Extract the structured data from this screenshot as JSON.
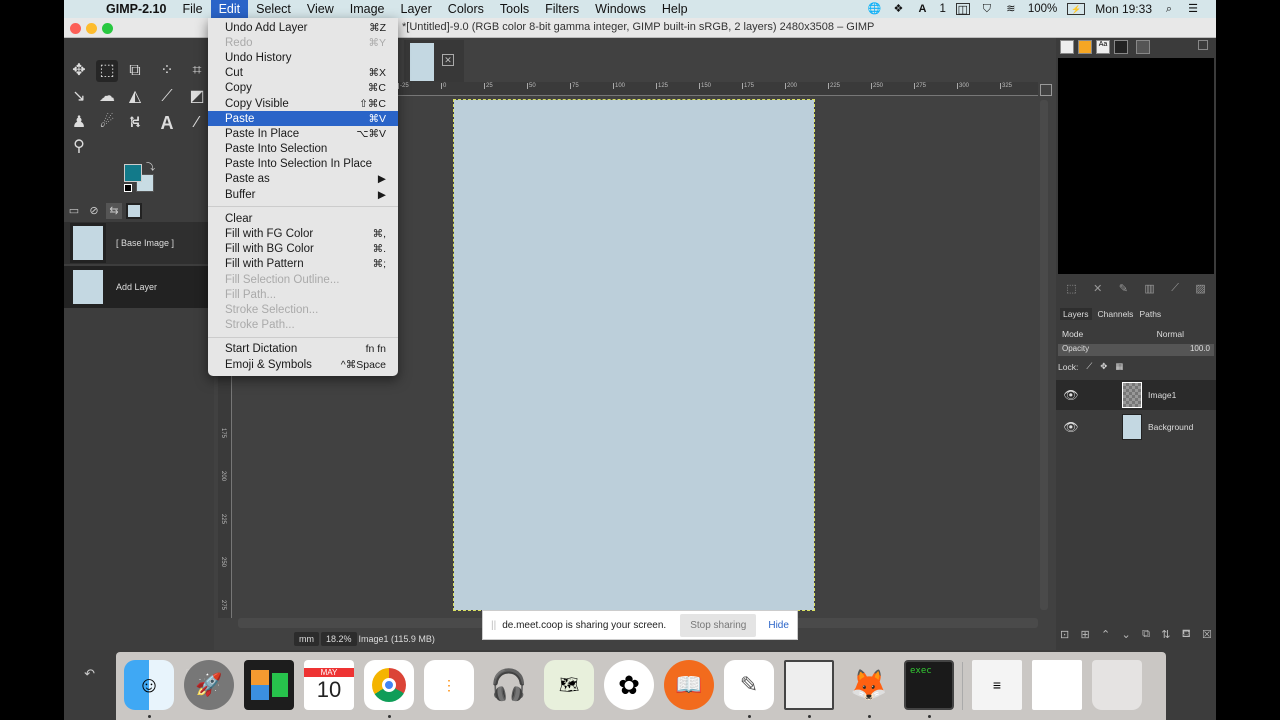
{
  "menubar": {
    "app_name": "GIMP-2.10",
    "items": [
      "File",
      "Edit",
      "Select",
      "View",
      "Image",
      "Layer",
      "Colors",
      "Tools",
      "Filters",
      "Windows",
      "Help"
    ],
    "active_item": "Edit",
    "battery": "100%",
    "clock": "Mon 19:33",
    "notification_count": "1"
  },
  "window": {
    "title": "*[Untitled]-9.0 (RGB color 8-bit gamma integer, GIMP built-in sRGB, 2 layers) 2480x3508 – GIMP"
  },
  "edit_menu": {
    "items": [
      {
        "label": "Undo Add Layer",
        "shortcut": "⌘Z",
        "enabled": true
      },
      {
        "label": "Redo",
        "shortcut": "⌘Y",
        "enabled": false
      },
      {
        "label": "Undo History",
        "shortcut": "",
        "enabled": true
      },
      {
        "label": "Cut",
        "shortcut": "⌘X",
        "enabled": true
      },
      {
        "label": "Copy",
        "shortcut": "⌘C",
        "enabled": true
      },
      {
        "label": "Copy Visible",
        "shortcut": "⇧⌘C",
        "enabled": true
      },
      {
        "label": "Paste",
        "shortcut": "⌘V",
        "enabled": true,
        "highlighted": true
      },
      {
        "label": "Paste In Place",
        "shortcut": "⌥⌘V",
        "enabled": true
      },
      {
        "label": "Paste Into Selection",
        "shortcut": "",
        "enabled": true
      },
      {
        "label": "Paste Into Selection In Place",
        "shortcut": "",
        "enabled": true
      },
      {
        "label": "Paste as",
        "shortcut": "▶",
        "enabled": true
      },
      {
        "label": "Buffer",
        "shortcut": "▶",
        "enabled": true
      },
      {
        "label": "Clear",
        "shortcut": "",
        "enabled": true
      },
      {
        "label": "Fill with FG Color",
        "shortcut": "⌘,",
        "enabled": true
      },
      {
        "label": "Fill with BG Color",
        "shortcut": "⌘.",
        "enabled": true
      },
      {
        "label": "Fill with Pattern",
        "shortcut": "⌘;",
        "enabled": true
      },
      {
        "label": "Fill Selection Outline...",
        "shortcut": "",
        "enabled": false
      },
      {
        "label": "Fill Path...",
        "shortcut": "",
        "enabled": false
      },
      {
        "label": "Stroke Selection...",
        "shortcut": "",
        "enabled": false
      },
      {
        "label": "Stroke Path...",
        "shortcut": "",
        "enabled": false
      },
      {
        "label": "Start Dictation",
        "shortcut": "fn fn",
        "enabled": true
      },
      {
        "label": "Emoji & Symbols",
        "shortcut": "^⌘Space",
        "enabled": true
      }
    ]
  },
  "toolbox": {
    "fg_color": "#127a8a",
    "bg_color": "#c8dce4",
    "history": [
      {
        "label": "[ Base Image ]"
      },
      {
        "label": "Add Layer"
      }
    ]
  },
  "rulers": {
    "horizontal_ticks": [
      "-25",
      "0",
      "25",
      "50",
      "75",
      "100",
      "125",
      "150",
      "175",
      "200",
      "225",
      "250",
      "275",
      "300",
      "325"
    ],
    "vertical_ticks": [
      "175",
      "200",
      "225",
      "250",
      "275"
    ]
  },
  "statusbar": {
    "unit": "mm",
    "zoom": "18.2%",
    "info": "Image1 (115.9 MB)"
  },
  "share_notice": {
    "text": "de.meet.coop is sharing your screen.",
    "stop_label": "Stop sharing",
    "hide_label": "Hide"
  },
  "layers_panel": {
    "tabs": [
      "Layers",
      "Channels",
      "Paths"
    ],
    "mode_label": "Mode",
    "mode_value": "Normal",
    "opacity_label": "Opacity",
    "opacity_value": "100.0",
    "lock_label": "Lock:",
    "layers": [
      {
        "name": "Image1",
        "visible": true,
        "selected": true
      },
      {
        "name": "Background",
        "visible": true,
        "selected": false
      }
    ]
  },
  "dock": {
    "apps": [
      "Finder",
      "Launchpad",
      "Mission Control",
      "Calendar",
      "Chrome",
      "Reminders",
      "Audacity",
      "Maps",
      "Photos",
      "iBooks",
      "TextEdit",
      "LibreOffice",
      "GIMP",
      "Terminal",
      "Documents",
      "Preview",
      "Trash"
    ],
    "calendar_month": "MAY",
    "calendar_day": "10",
    "terminal_text": "exec"
  }
}
